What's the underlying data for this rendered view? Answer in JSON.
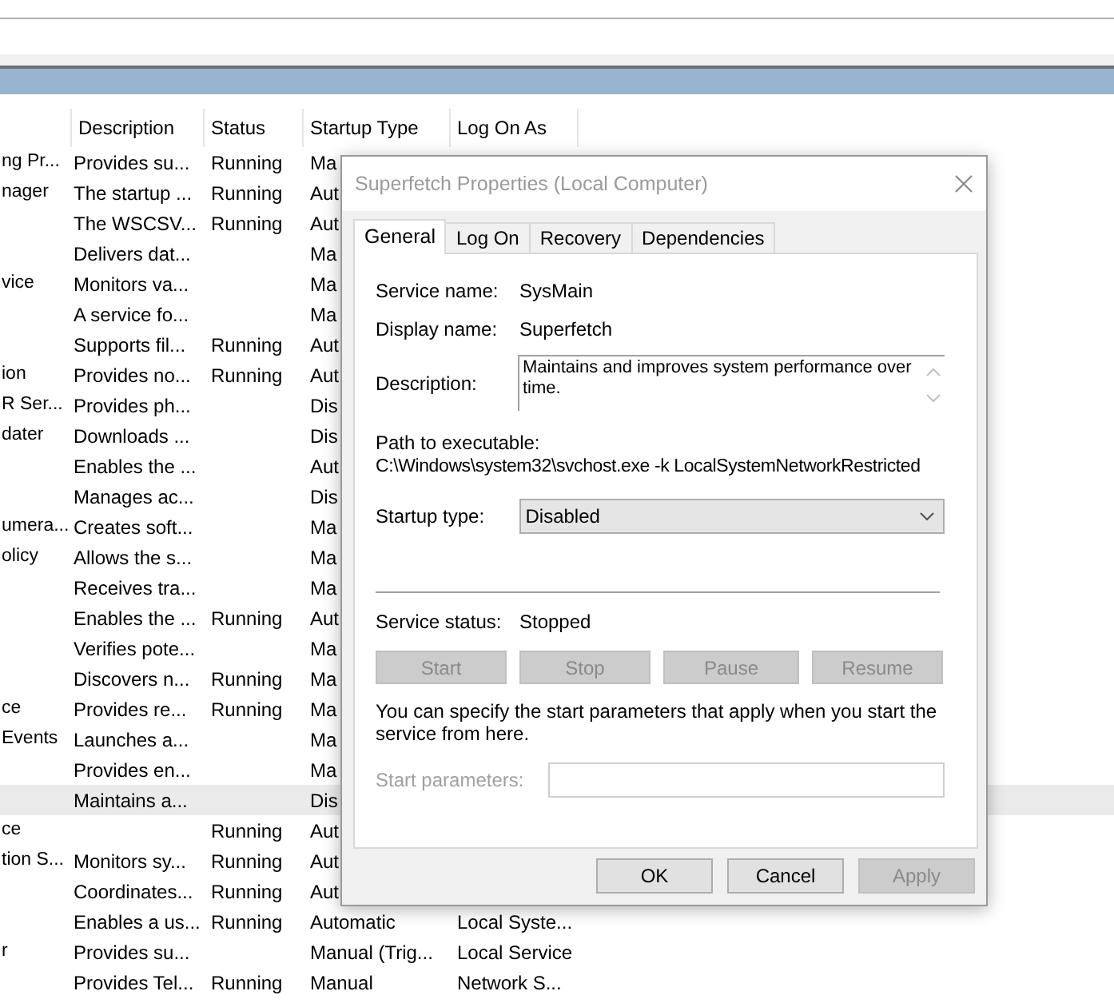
{
  "table": {
    "columns": [
      {
        "label": "Description"
      },
      {
        "label": "Status"
      },
      {
        "label": "Startup Type"
      },
      {
        "label": "Log On As"
      }
    ],
    "rows": [
      {
        "column_1": "ng Pr...",
        "description": "Provides su...",
        "status": "Running",
        "startup_type": "Ma",
        "selected": false
      },
      {
        "column_1": "nager",
        "description": "The startup ...",
        "status": "Running",
        "startup_type": "Aut",
        "selected": false
      },
      {
        "description": "The WSCSV...",
        "status": "Running",
        "startup_type": "Aut",
        "selected": false
      },
      {
        "description": "Delivers dat...",
        "startup_type": "Ma",
        "selected": false
      },
      {
        "column_1": "vice",
        "description": "Monitors va...",
        "startup_type": "Ma",
        "selected": false
      },
      {
        "description": "A service fo...",
        "startup_type": "Ma",
        "selected": false
      },
      {
        "description": "Supports fil...",
        "status": "Running",
        "startup_type": "Aut",
        "selected": false
      },
      {
        "column_1": "ion",
        "description": "Provides no...",
        "status": "Running",
        "startup_type": "Aut",
        "selected": false
      },
      {
        "column_1": "R Ser...",
        "description": "Provides ph...",
        "startup_type": "Dis",
        "selected": false
      },
      {
        "column_1": "dater",
        "description": "Downloads ...",
        "startup_type": "Dis",
        "selected": false
      },
      {
        "description": "Enables the ...",
        "startup_type": "Aut",
        "selected": false
      },
      {
        "description": "Manages ac...",
        "startup_type": "Dis",
        "selected": false
      },
      {
        "column_1": "umera...",
        "description": "Creates soft...",
        "startup_type": "Ma",
        "selected": false
      },
      {
        "column_1": "olicy",
        "description": "Allows the s...",
        "startup_type": "Ma",
        "selected": false
      },
      {
        "description": "Receives tra...",
        "startup_type": "Ma",
        "selected": false
      },
      {
        "description": "Enables the ...",
        "status": "Running",
        "startup_type": "Aut",
        "selected": false
      },
      {
        "description": "Verifies pote...",
        "startup_type": "Ma",
        "selected": false
      },
      {
        "description": "Discovers n...",
        "status": "Running",
        "startup_type": "Ma",
        "selected": false
      },
      {
        "column_1": "ce",
        "description": "Provides re...",
        "status": "Running",
        "startup_type": "Ma",
        "selected": false
      },
      {
        "column_1": "Events",
        "description": "Launches a...",
        "startup_type": "Ma",
        "selected": false
      },
      {
        "description": "Provides en...",
        "startup_type": "Ma",
        "selected": false
      },
      {
        "description": "Maintains a...",
        "startup_type": "Dis",
        "selected": true
      },
      {
        "column_1": "ce",
        "status": "Running",
        "startup_type": "Aut",
        "selected": false
      },
      {
        "column_1": "tion S...",
        "description": "Monitors sy...",
        "status": "Running",
        "startup_type": "Aut",
        "selected": false
      },
      {
        "description": "Coordinates...",
        "status": "Running",
        "startup_type": "Aut",
        "selected": false
      },
      {
        "description": "Enables a us...",
        "status": "Running",
        "startup_type": "Automatic",
        "log_on_as": "Local Syste...",
        "selected": false
      },
      {
        "column_1": "r",
        "description": "Provides su...",
        "startup_type": "Manual (Trig...",
        "log_on_as": "Local Service",
        "selected": false
      },
      {
        "description": "Provides Tel...",
        "status": "Running",
        "startup_type": "Manual",
        "log_on_as": "Network S...",
        "selected": false
      }
    ]
  },
  "dialog": {
    "title": "Superfetch Properties (Local Computer)",
    "tabs": [
      {
        "label": "General",
        "selected": true
      },
      {
        "label": "Log On",
        "selected": false
      },
      {
        "label": "Recovery",
        "selected": false
      },
      {
        "label": "Dependencies",
        "selected": false
      }
    ],
    "service_name": {
      "label": "Service name:",
      "value": "SysMain"
    },
    "display_name": {
      "label": "Display name:",
      "value": "Superfetch"
    },
    "description": {
      "label": "Description:",
      "value": "Maintains and improves system performance over time."
    },
    "path": {
      "label": "Path to executable:",
      "value": "C:\\Windows\\system32\\svchost.exe -k LocalSystemNetworkRestricted"
    },
    "startup_type": {
      "label": "Startup type:",
      "value": "Disabled"
    },
    "service_status": {
      "label": "Service status:",
      "value": "Stopped"
    },
    "control_buttons": [
      {
        "label": "Start",
        "disabled": true
      },
      {
        "label": "Stop",
        "disabled": true
      },
      {
        "label": "Pause",
        "disabled": true
      },
      {
        "label": "Resume",
        "disabled": true
      }
    ],
    "hint": "You can specify the start parameters that apply when you start the service from here.",
    "start_parameters": {
      "label": "Start parameters:",
      "disabled": true
    },
    "buttons": [
      {
        "label": "OK",
        "disabled": false
      },
      {
        "label": "Cancel",
        "disabled": false
      },
      {
        "label": "Apply",
        "disabled": true
      }
    ]
  }
}
